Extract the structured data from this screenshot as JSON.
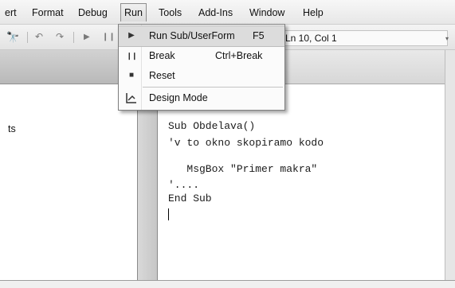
{
  "menubar": {
    "items": [
      {
        "label": "ert"
      },
      {
        "label": "Format"
      },
      {
        "label": "Debug"
      },
      {
        "label": "Run"
      },
      {
        "label": "Tools"
      },
      {
        "label": "Add-Ins"
      },
      {
        "label": "Window"
      },
      {
        "label": "Help"
      }
    ]
  },
  "toolbar": {
    "status": "Ln 10, Col 1"
  },
  "run_menu": {
    "items": [
      {
        "label": "Run Sub/UserForm",
        "shortcut": "F5",
        "icon": "play-icon"
      },
      {
        "label": "Break",
        "shortcut": "Ctrl+Break",
        "icon": "pause-icon"
      },
      {
        "label": "Reset",
        "shortcut": "",
        "icon": "stop-icon"
      },
      {
        "label": "Design Mode",
        "shortcut": "",
        "icon": "design-mode-icon"
      }
    ]
  },
  "left_pane": {
    "text": "ts"
  },
  "code": {
    "lines": [
      "Sub Obdelava()",
      "'v to okno skopiramo kodo",
      "",
      "   MsgBox \"Primer makra\"",
      "'....",
      "End Sub"
    ]
  }
}
